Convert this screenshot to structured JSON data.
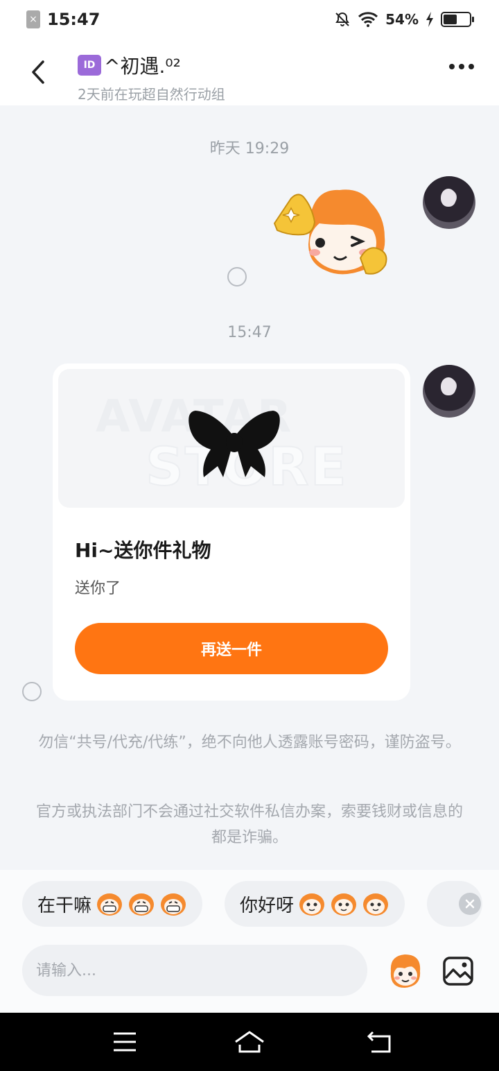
{
  "status_bar": {
    "time": "15:47",
    "battery": "54%",
    "battery_level": 0.54,
    "icons": [
      "sim-error-icon",
      "mute-bell-icon",
      "wifi-icon",
      "charging-icon",
      "battery-icon"
    ]
  },
  "header": {
    "badge": "ID",
    "title": "^初遇.⁰²",
    "subtitle": "2天前在玩超自然行动组",
    "icons": [
      "back-icon",
      "more-icon"
    ]
  },
  "chat": {
    "timestamp_1": "昨天 19:29",
    "timestamp_2": "15:47",
    "gift_card": {
      "watermark_line1": "AVATAR",
      "watermark_line2": "STORE",
      "title": "Hi~送你件礼物",
      "description": "送你了",
      "button_label": "再送一件"
    },
    "warning_1": "勿信“共号/代充/代练”，绝不向他人透露账号密码，谨防盗号。",
    "warning_2": "官方或执法部门不会通过社交软件私信办案，索要钱财或信息的都是诈骗。"
  },
  "quick_replies": [
    {
      "text": "在干嘛",
      "emoji_count": 3
    },
    {
      "text": "你好呀",
      "emoji_count": 3
    }
  ],
  "input": {
    "placeholder": "请输入..."
  },
  "colors": {
    "accent": "#ff7512",
    "background": "#f3f5f8"
  },
  "nav_bar": {
    "icons": [
      "menu-icon",
      "home-icon",
      "back-nav-icon"
    ]
  }
}
